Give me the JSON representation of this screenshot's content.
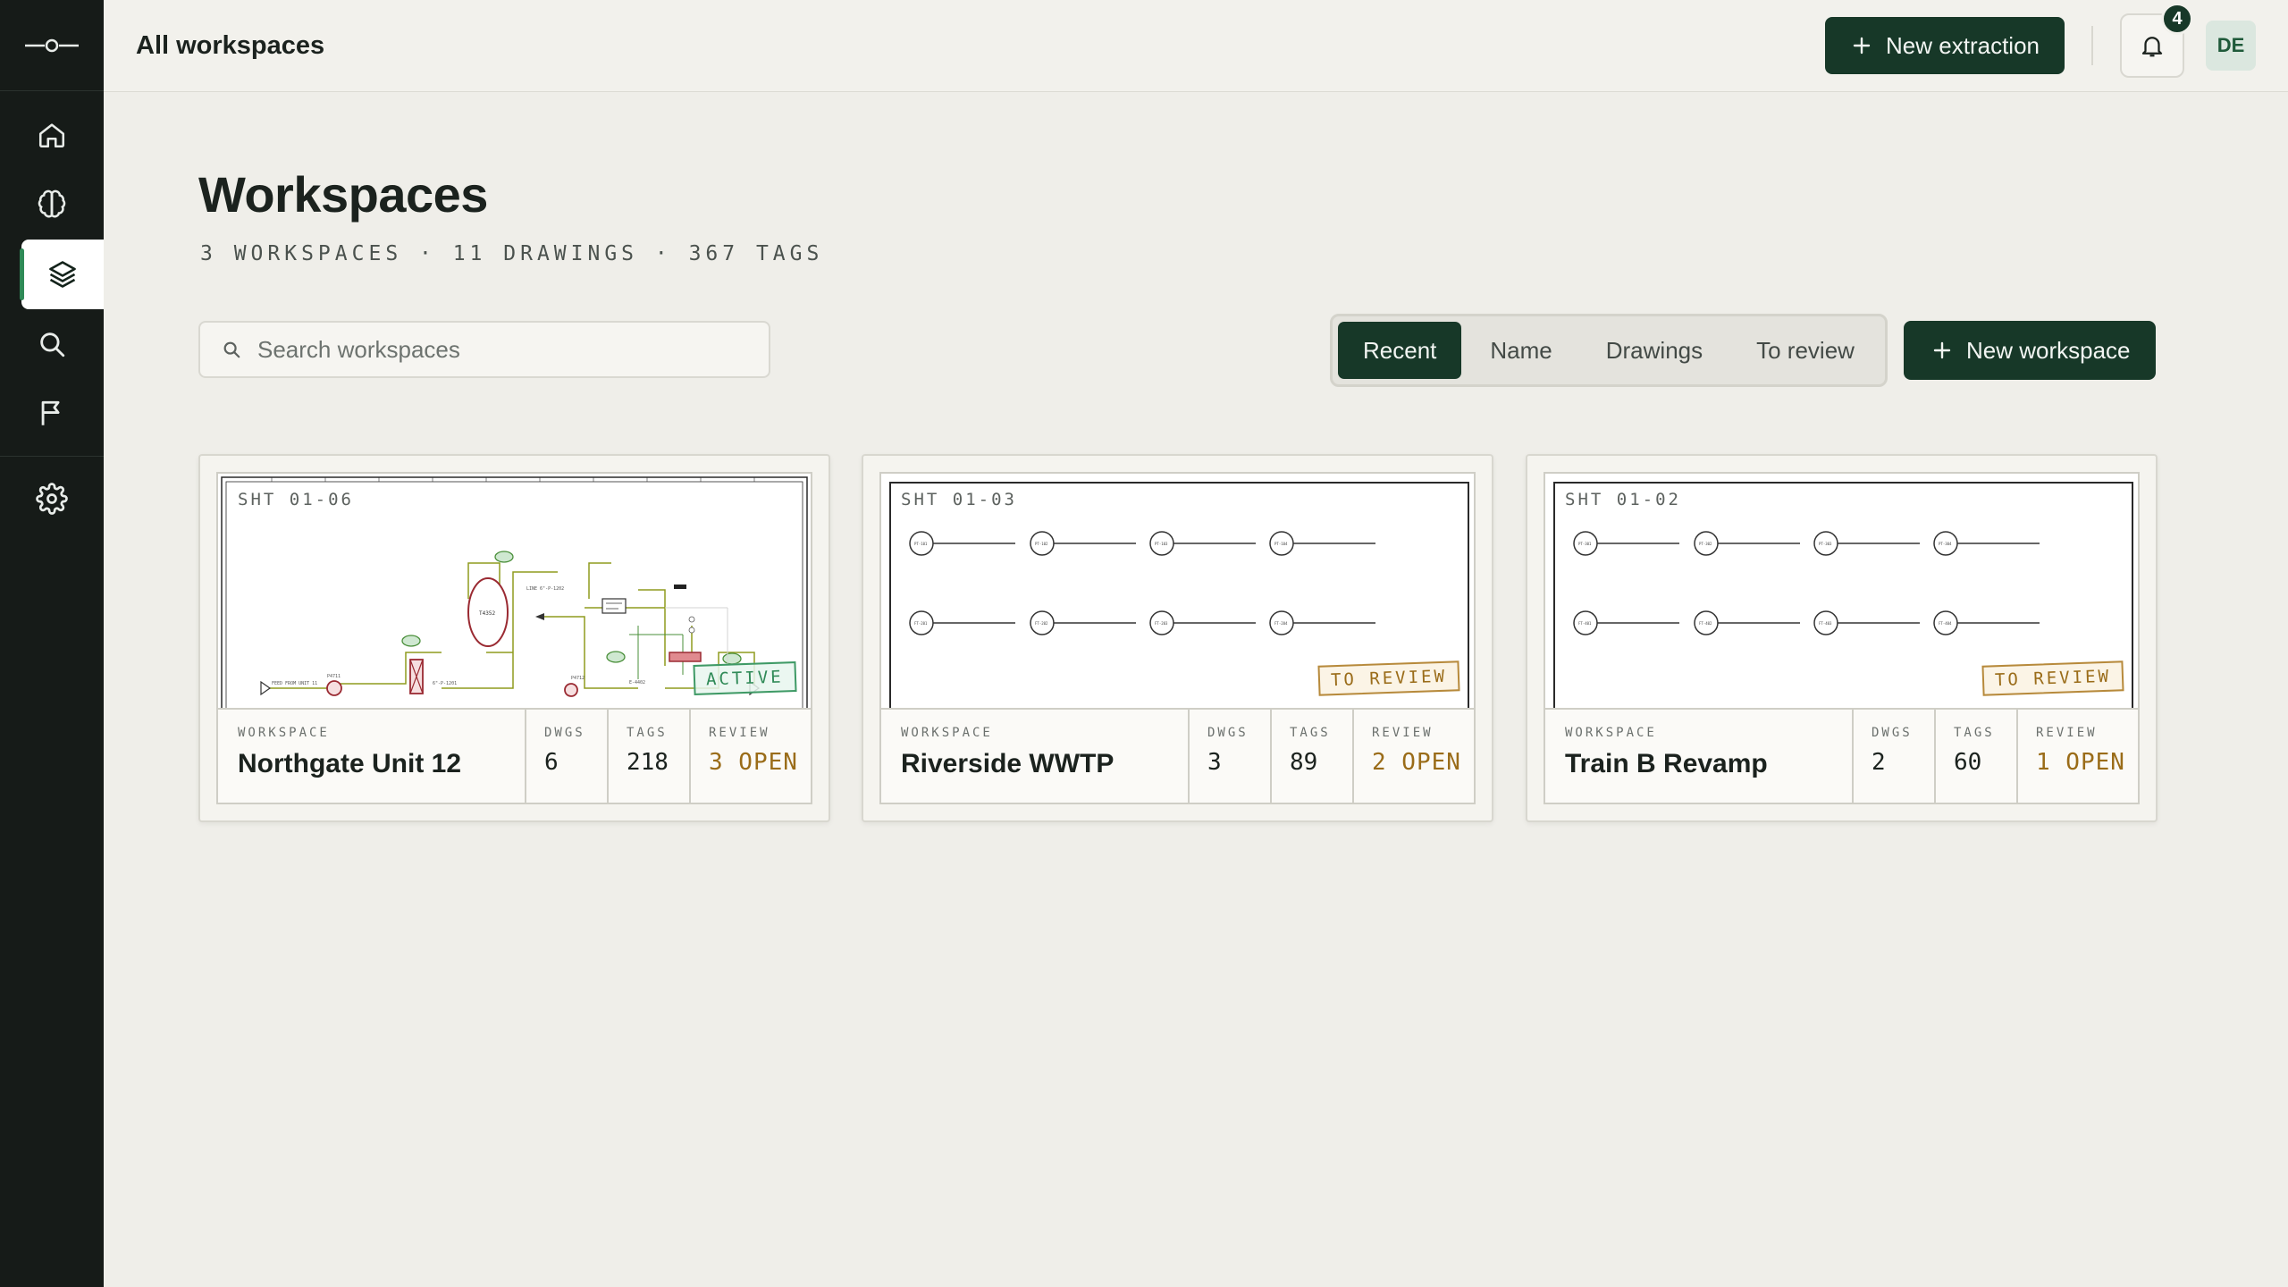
{
  "app": {
    "nav": [
      {
        "icon": "home-icon"
      },
      {
        "icon": "brain-icon"
      },
      {
        "icon": "layers-icon",
        "active": true
      },
      {
        "icon": "search-icon"
      },
      {
        "icon": "flag-icon"
      },
      {
        "icon": "gear-icon"
      }
    ]
  },
  "topbar": {
    "title": "All workspaces",
    "new_extraction": "New extraction",
    "notifications_count": "4",
    "avatar_initials": "DE"
  },
  "page": {
    "title": "Workspaces",
    "meta": "3 WORKSPACES · 11 DRAWINGS · 367 TAGS",
    "search_placeholder": "Search workspaces",
    "sort_options": [
      "Recent",
      "Name",
      "Drawings",
      "To review"
    ],
    "sort_selected": "Recent",
    "new_workspace": "New workspace"
  },
  "cards": [
    {
      "sheet": "SHT 01-06",
      "status": "ACTIVE",
      "workspace_label": "WORKSPACE",
      "name": "Northgate Unit 12",
      "dwgs_label": "DWGS",
      "dwgs": "6",
      "tags_label": "TAGS",
      "tags": "218",
      "review_label": "REVIEW",
      "review": "3 OPEN"
    },
    {
      "sheet": "SHT 01-03",
      "status": "TO REVIEW",
      "workspace_label": "WORKSPACE",
      "name": "Riverside WWTP",
      "dwgs_label": "DWGS",
      "dwgs": "3",
      "tags_label": "TAGS",
      "tags": "89",
      "review_label": "REVIEW",
      "review": "2 OPEN"
    },
    {
      "sheet": "SHT 01-02",
      "status": "TO REVIEW",
      "workspace_label": "WORKSPACE",
      "name": "Train B Revamp",
      "dwgs_label": "DWGS",
      "dwgs": "2",
      "tags_label": "TAGS",
      "tags": "60",
      "review_label": "REVIEW",
      "review": "1 OPEN"
    }
  ],
  "colors": {
    "sidebar": "#161b18",
    "accent_dark": "#173828",
    "accent_green": "#2f8a57",
    "review_amber": "#9a6c19"
  }
}
